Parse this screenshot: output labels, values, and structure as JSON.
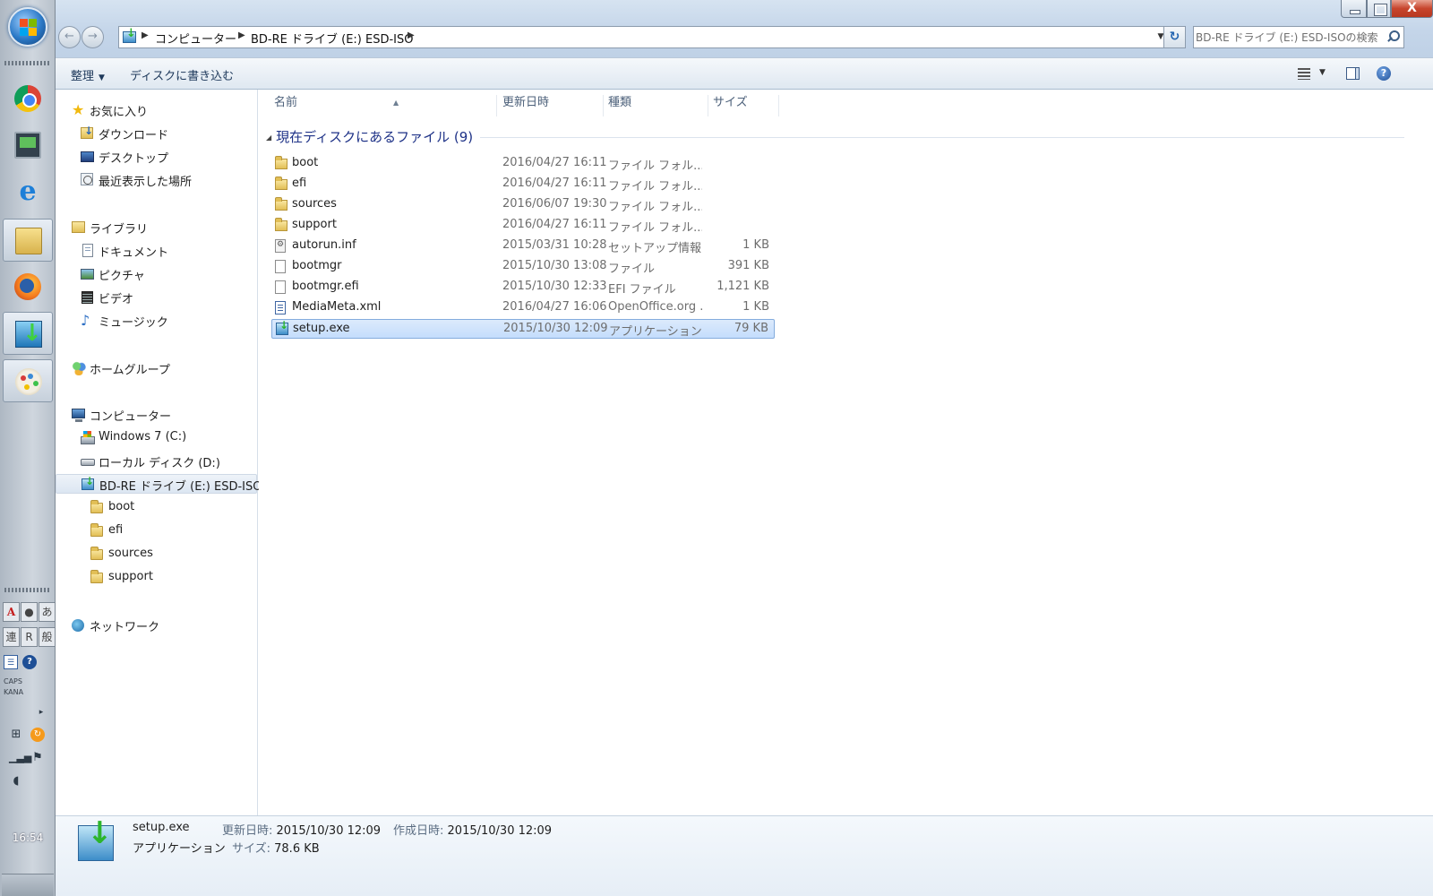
{
  "taskbar": {
    "clock": "16:54",
    "ime": {
      "row1": [
        "A",
        "●",
        "あ"
      ],
      "row2": [
        "連",
        "R",
        "般"
      ]
    },
    "caps": "CAPS",
    "kana": "KANA"
  },
  "window": {
    "address": {
      "crumbs": [
        "コンピューター",
        "BD-RE ドライブ (E:) ESD-ISO"
      ]
    },
    "search": {
      "placeholder": "BD-RE ドライブ (E:) ESD-ISOの検索"
    },
    "close_label": "X"
  },
  "commandbar": {
    "organize": "整理",
    "burn": "ディスクに書き込む"
  },
  "navpane": {
    "favorites": {
      "label": "お気に入り",
      "items": [
        "ダウンロード",
        "デスクトップ",
        "最近表示した場所"
      ]
    },
    "libraries": {
      "label": "ライブラリ",
      "items": [
        "ドキュメント",
        "ピクチャ",
        "ビデオ",
        "ミュージック"
      ]
    },
    "homegroup": "ホームグループ",
    "computer": {
      "label": "コンピューター",
      "drives": [
        "Windows 7 (C:)",
        "ローカル ディスク (D:)",
        "BD-RE ドライブ (E:) ESD-ISO"
      ],
      "folders": [
        "boot",
        "efi",
        "sources",
        "support"
      ]
    },
    "network": "ネットワーク"
  },
  "filelist": {
    "columns": [
      "名前",
      "更新日時",
      "種類",
      "サイズ"
    ],
    "group_header": "現在ディスクにあるファイル (9)",
    "files": [
      {
        "name": "boot",
        "date": "2016/04/27 16:11",
        "type": "ファイル フォル...",
        "size": "",
        "icon": "folder"
      },
      {
        "name": "efi",
        "date": "2016/04/27 16:11",
        "type": "ファイル フォル...",
        "size": "",
        "icon": "folder"
      },
      {
        "name": "sources",
        "date": "2016/06/07 19:30",
        "type": "ファイル フォル...",
        "size": "",
        "icon": "folder"
      },
      {
        "name": "support",
        "date": "2016/04/27 16:11",
        "type": "ファイル フォル...",
        "size": "",
        "icon": "folder"
      },
      {
        "name": "autorun.inf",
        "date": "2015/03/31 10:28",
        "type": "セットアップ情報",
        "size": "1 KB",
        "icon": "settings"
      },
      {
        "name": "bootmgr",
        "date": "2015/10/30 13:08",
        "type": "ファイル",
        "size": "391 KB",
        "icon": "file"
      },
      {
        "name": "bootmgr.efi",
        "date": "2015/10/30 12:33",
        "type": "EFI ファイル",
        "size": "1,121 KB",
        "icon": "file"
      },
      {
        "name": "MediaMeta.xml",
        "date": "2016/04/27 16:06",
        "type": "OpenOffice.org ...",
        "size": "1 KB",
        "icon": "xml"
      },
      {
        "name": "setup.exe",
        "date": "2015/10/30 12:09",
        "type": "アプリケーション",
        "size": "79 KB",
        "icon": "app"
      }
    ]
  },
  "details": {
    "name": "setup.exe",
    "type": "アプリケーション",
    "modified_label": "更新日時:",
    "modified": "2015/10/30 12:09",
    "created_label": "作成日時:",
    "created": "2015/10/30 12:09",
    "size_label": "サイズ:",
    "size": "78.6 KB"
  }
}
